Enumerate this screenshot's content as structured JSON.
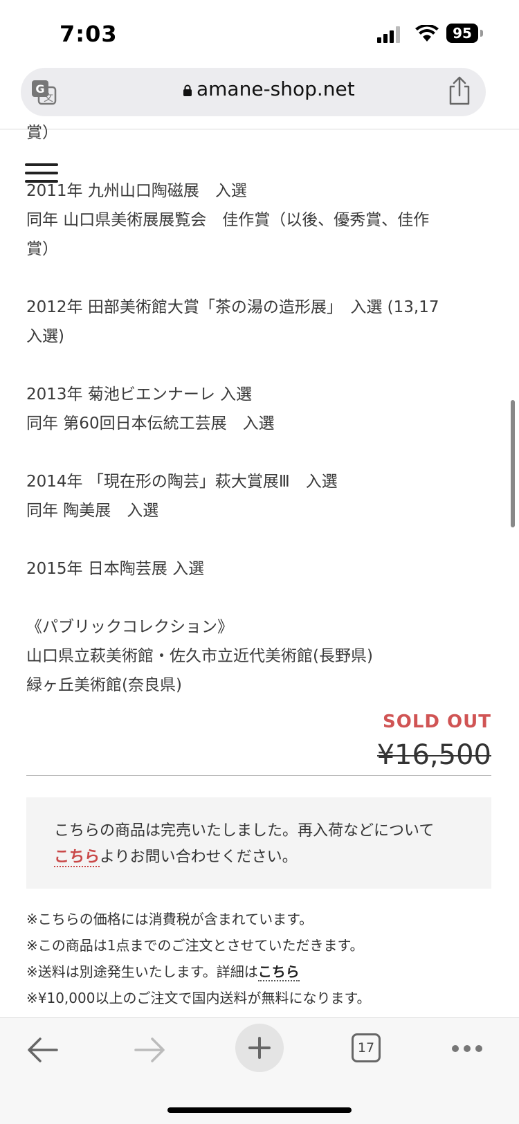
{
  "status_bar": {
    "time": "7:03",
    "battery": "95"
  },
  "browser": {
    "url": "amane-shop.net",
    "tab_count": "17"
  },
  "content": {
    "partial_top": "賞）",
    "lines": [
      "2011年 九州山口陶磁展　入選",
      "同年 山口県美術展展覧会　佳作賞（以後、優秀賞、佳作",
      "賞）",
      "2012年 田部美術館大賞「茶の湯の造形展」　入選 (13,17",
      "入選)",
      "2013年 菊池ビエンナーレ 入選",
      "同年 第60回日本伝統工芸展　入選",
      "2014年 「現在形の陶芸」萩大賞展Ⅲ　入選",
      "同年 陶美展　入選",
      "2015年 日本陶芸展 入選",
      "《パブリックコレクション》",
      "山口県立萩美術館・佐久市立近代美術館(長野県)",
      "緑ヶ丘美術館(奈良県)"
    ]
  },
  "product": {
    "status": "SOLD OUT",
    "price": "¥16,500"
  },
  "notice": {
    "line1": "こちらの商品は完売いたしました。再入荷などについて",
    "link": "こちら",
    "line2_rest": "よりお問い合わせください。"
  },
  "notes": {
    "n1": "※こちらの価格には消費税が含まれています。",
    "n2": "※この商品は1点までのご注文とさせていただきます。",
    "n3_pre": "※送料は別途発生いたします。詳細は",
    "n3_link": "こちら",
    "n4": "※¥10,000以上のご注文で国内送料が無料になります。"
  },
  "colors": {
    "accent": "#d05454",
    "text": "#333333"
  }
}
